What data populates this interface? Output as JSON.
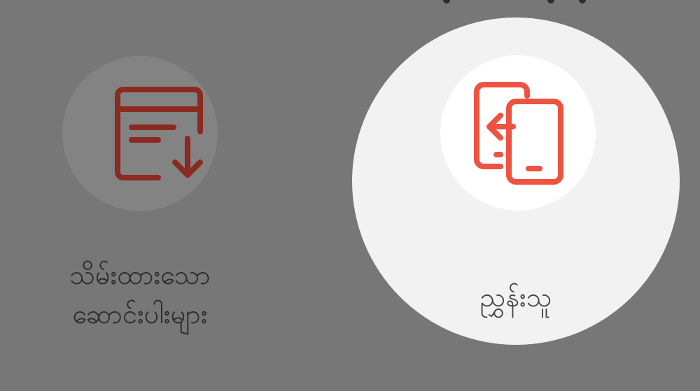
{
  "options": [
    {
      "label_line1": "သိမ်းထားသော",
      "label_line2": "ဆောင်းပါးများ",
      "icon": "saved-articles-download-icon",
      "selected": false,
      "icon_color": "#8a2a20"
    },
    {
      "label": "ညွှန်းသူ",
      "icon": "phone-transfer-icon",
      "selected": true,
      "icon_color": "#ee5240"
    }
  ],
  "colors": {
    "background": "#777777",
    "selected_background": "#f2f2f2"
  }
}
